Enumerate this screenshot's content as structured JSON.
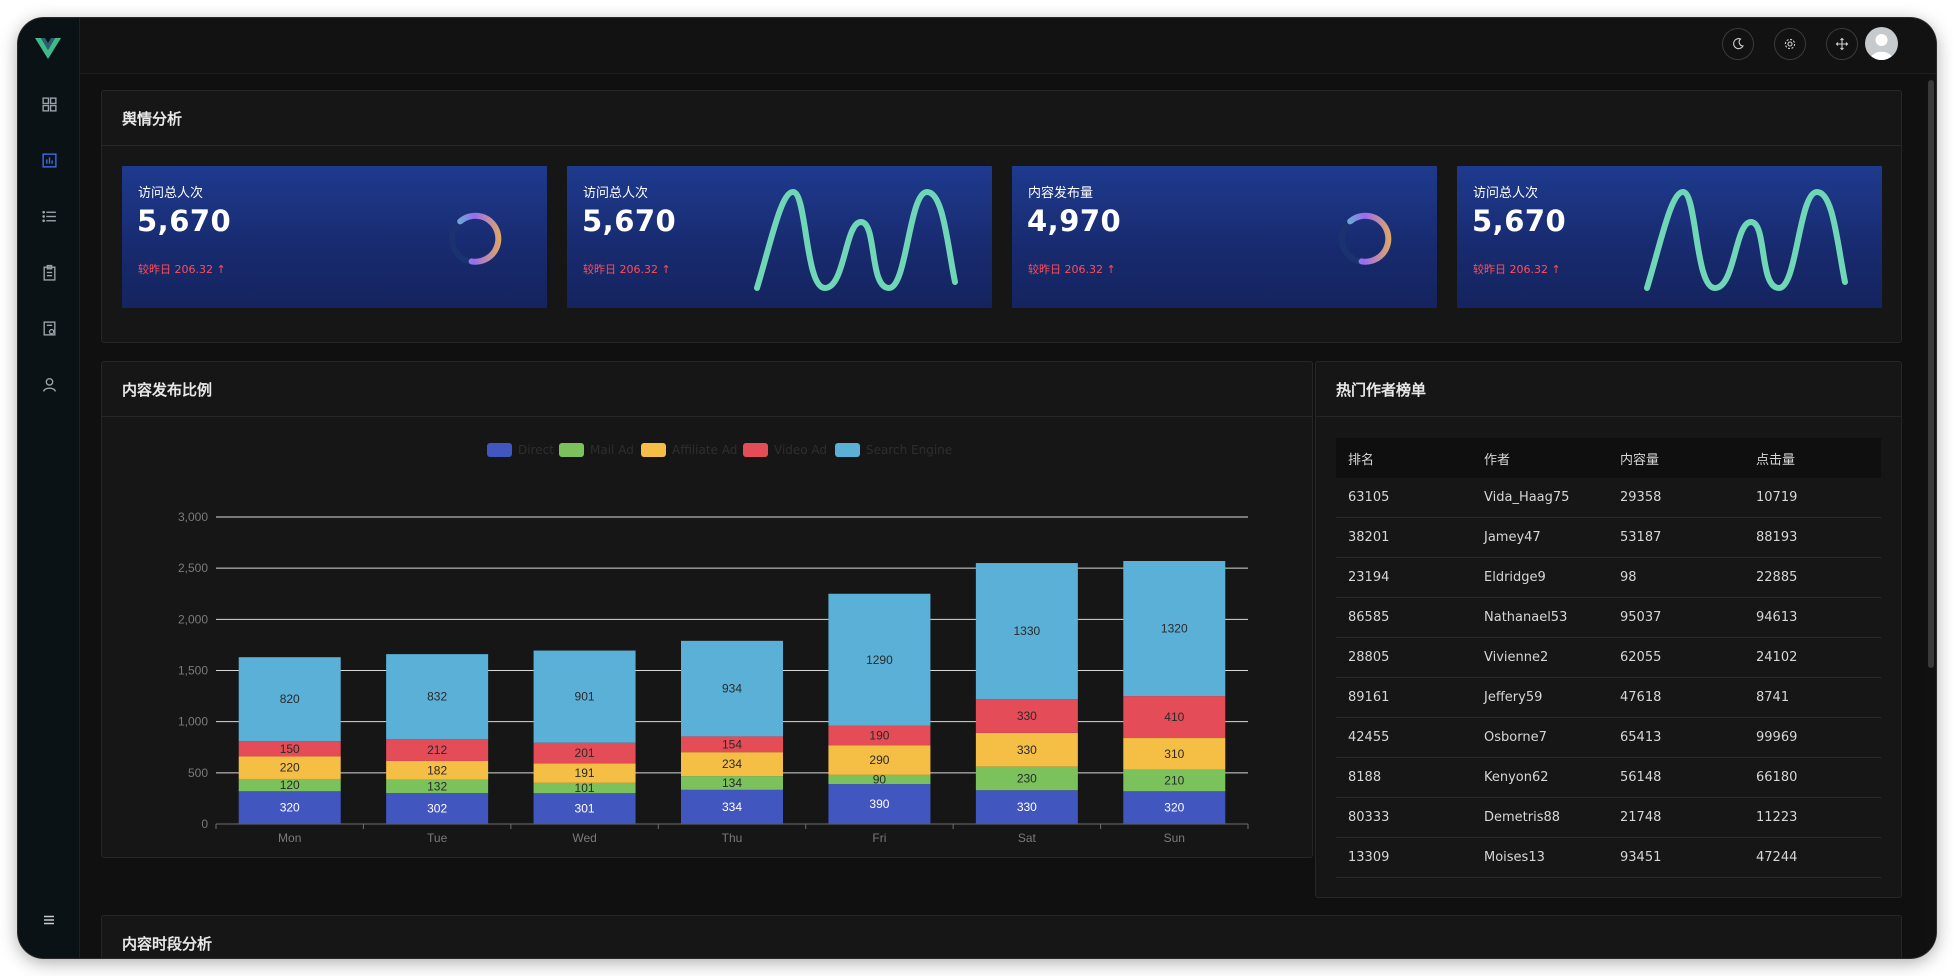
{
  "app": {
    "nav": [
      {
        "key": "dashboard",
        "icon": "grid-icon"
      },
      {
        "key": "analysis",
        "icon": "bar-chart-icon",
        "active": true
      },
      {
        "key": "list",
        "icon": "list-icon"
      },
      {
        "key": "clipboard",
        "icon": "clipboard-icon"
      },
      {
        "key": "report",
        "icon": "report-icon"
      },
      {
        "key": "user",
        "icon": "user-icon"
      }
    ],
    "accent": "#3a6cf0",
    "logo_color": "#3fba8a"
  },
  "topbar": {
    "icons": [
      "moon-icon",
      "gear-icon",
      "fullscreen-icon",
      "avatar"
    ]
  },
  "sentiment": {
    "title": "舆情分析",
    "cards": [
      {
        "label": "访问总人次",
        "value": "5,670",
        "compare": "较昨日 206.32",
        "graphic": "ring"
      },
      {
        "label": "访问总人次",
        "value": "5,670",
        "compare": "较昨日 206.32",
        "graphic": "wave"
      },
      {
        "label": "内容发布量",
        "value": "4,970",
        "compare": "较昨日 206.32",
        "graphic": "ring"
      },
      {
        "label": "访问总人次",
        "value": "5,670",
        "compare": "较昨日 206.32",
        "graphic": "wave"
      }
    ]
  },
  "content_ratio": {
    "title": "内容发布比例"
  },
  "chart_data": {
    "type": "bar",
    "stacked": true,
    "categories": [
      "Mon",
      "Tue",
      "Wed",
      "Thu",
      "Fri",
      "Sat",
      "Sun"
    ],
    "series": [
      {
        "name": "Direct",
        "color": "#4256c0",
        "values": [
          320,
          302,
          301,
          334,
          390,
          330,
          320
        ]
      },
      {
        "name": "Mail Ad",
        "color": "#7bc25c",
        "values": [
          120,
          132,
          101,
          134,
          90,
          230,
          210
        ]
      },
      {
        "name": "Affiliate Ad",
        "color": "#f5be45",
        "values": [
          220,
          182,
          191,
          234,
          290,
          330,
          310
        ]
      },
      {
        "name": "Video Ad",
        "color": "#e44c57",
        "values": [
          150,
          212,
          201,
          154,
          190,
          330,
          410
        ]
      },
      {
        "name": "Search Engine",
        "color": "#5bb0d8",
        "values": [
          820,
          832,
          901,
          934,
          1290,
          1330,
          1320
        ]
      }
    ],
    "y_ticks": [
      "0",
      "500",
      "1,000",
      "1,500",
      "2,000",
      "2,500",
      "3,000"
    ],
    "ylim": [
      0,
      3000
    ],
    "grid": true,
    "legend_position": "top-center"
  },
  "authors": {
    "title": "热门作者榜单",
    "columns": [
      "排名",
      "作者",
      "内容量",
      "点击量"
    ],
    "rows": [
      [
        "63105",
        "Vida_Haag75",
        "29358",
        "10719"
      ],
      [
        "38201",
        "Jamey47",
        "53187",
        "88193"
      ],
      [
        "23194",
        "Eldridge9",
        "98",
        "22885"
      ],
      [
        "86585",
        "Nathanael53",
        "95037",
        "94613"
      ],
      [
        "28805",
        "Vivienne2",
        "62055",
        "24102"
      ],
      [
        "89161",
        "Jeffery59",
        "47618",
        "8741"
      ],
      [
        "42455",
        "Osborne7",
        "65413",
        "99969"
      ],
      [
        "8188",
        "Kenyon62",
        "56148",
        "66180"
      ],
      [
        "80333",
        "Demetris88",
        "21748",
        "11223"
      ],
      [
        "13309",
        "Moises13",
        "93451",
        "47244"
      ]
    ]
  },
  "time_analysis": {
    "title": "内容时段分析"
  }
}
